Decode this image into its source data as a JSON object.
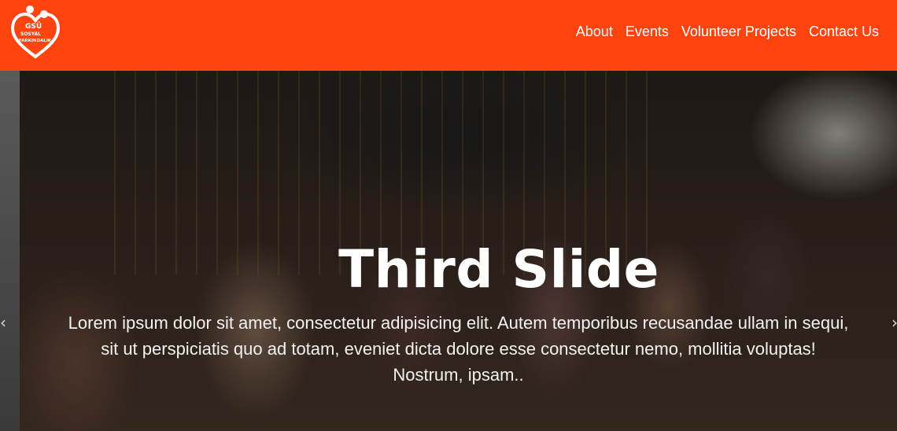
{
  "brand": {
    "logo_icon": "heart-people-logo-icon",
    "logo_lines": [
      "GSÜ",
      "SOSYAL",
      "FARKINDALIK"
    ],
    "accent_color": "#ff4410"
  },
  "nav": {
    "items": [
      {
        "label": "About"
      },
      {
        "label": "Events"
      },
      {
        "label": "Volunteer Projects"
      },
      {
        "label": "Contact Us"
      }
    ]
  },
  "slide": {
    "title": "Third Slide",
    "text": "Lorem ipsum dolor sit amet, consectetur adipisicing elit. Autem temporibus recusandae ullam in sequi, sit ut perspiciatis quo ad totam, eveniet dicta dolore esse consectetur nemo, mollitia voluptas! Nostrum, ipsam.."
  },
  "controls": {
    "prev_icon": "chevron-left-icon",
    "next_icon": "chevron-right-icon",
    "prev_glyph": "‹",
    "next_glyph": "›"
  }
}
